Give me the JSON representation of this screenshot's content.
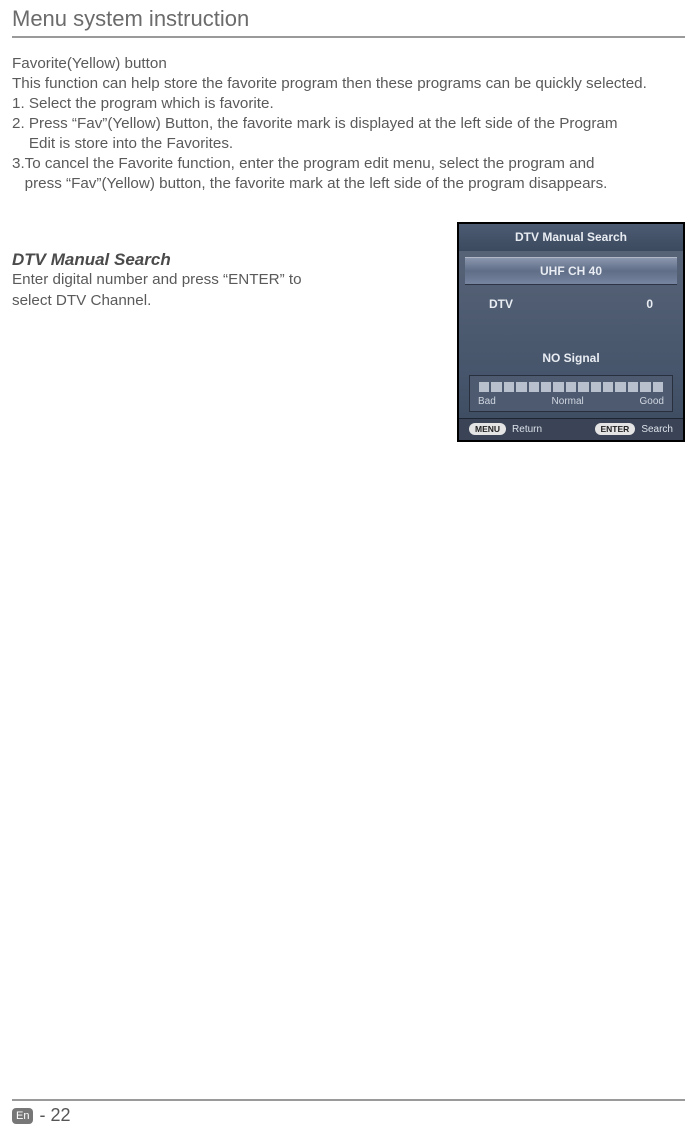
{
  "page_title": "Menu system instruction",
  "section_fav_heading": "Favorite(Yellow) button",
  "section_fav_intro": "This function can help store the favorite program then these programs can be quickly selected.",
  "fav_step1": "1. Select the program which is favorite.",
  "fav_step2a": "2. Press “Fav”(Yellow) Button, the favorite mark is displayed at the left side of the Program",
  "fav_step2b": "    Edit is store into the Favorites.",
  "fav_step3a": "3.To cancel the Favorite function, enter the program edit menu, select the program and ",
  "fav_step3b": "   press “Fav”(Yellow) button, the favorite mark at the left side of the program disappears.",
  "dtv_heading": "DTV Manual Search",
  "dtv_body_line1": "Enter digital number and press “ENTER” to",
  "dtv_body_line2": "select DTV Channel.",
  "osd": {
    "title": "DTV Manual Search",
    "channel": "UHF CH 40",
    "row_label": "DTV",
    "row_value": "0",
    "nosignal": "NO Signal",
    "signal_labels": {
      "bad": "Bad",
      "normal": "Normal",
      "good": "Good"
    },
    "footer_menu_btn": "MENU",
    "footer_menu_label": "Return",
    "footer_enter_btn": "ENTER",
    "footer_enter_label": "Search"
  },
  "footer": {
    "lang_badge": "En",
    "page_number": "- 22"
  }
}
